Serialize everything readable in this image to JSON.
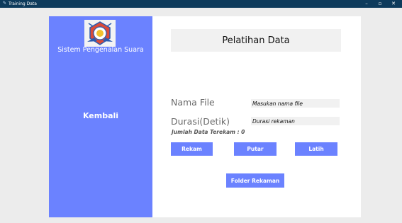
{
  "window": {
    "title": "Training Data",
    "app_icon": "app-icon",
    "minimize_glyph": "–",
    "maximize_glyph": "▫",
    "close_glyph": "✕"
  },
  "sidebar": {
    "logo": "crest-logo-icon",
    "app_name": "Sistem Pengenalan Suara",
    "back_label": "Kembali"
  },
  "main": {
    "title": "Pelatihan Data",
    "file_label": "Nama File",
    "file_placeholder": "Masukan nama file",
    "duration_label": "Durasi(Detik)",
    "duration_placeholder": "Durasi rekaman",
    "record_count": "Jumlah Data Terekam : 0",
    "buttons": {
      "record": "Rekam",
      "play": "Putar",
      "train": "Latih",
      "folder": "Folder Rekaman"
    }
  },
  "colors": {
    "titlebar": "#0e3b5c",
    "accent": "#6b82ff",
    "window_bg": "#ececec",
    "panel": "#ffffff",
    "field_bg": "#f1f1f1"
  }
}
